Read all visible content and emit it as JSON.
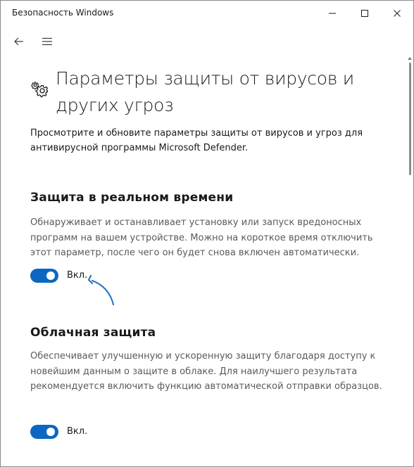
{
  "window": {
    "title": "Безопасность Windows",
    "controls": {
      "minimize_icon": "minimize-icon",
      "maximize_icon": "maximize-icon",
      "close_icon": "close-icon"
    }
  },
  "nav": {
    "back_icon": "back-arrow-icon",
    "menu_icon": "hamburger-menu-icon"
  },
  "page": {
    "icon": "gears-settings-icon",
    "title": "Параметры защиты от вирусов и других угроз",
    "intro": "Просмотрите и обновите параметры защиты от вирусов и угроз для антивирусной программы Microsoft Defender."
  },
  "sections": [
    {
      "title": "Защита в реальном времени",
      "description": "Обнаруживает и останавливает установку или запуск вредоносных программ на вашем устройстве. Можно на короткое время отключить этот параметр, после чего он будет снова включен автоматически.",
      "toggle_on": true,
      "toggle_label": "Вкл."
    },
    {
      "title": "Облачная защита",
      "description": "Обеспечивает улучшенную и ускоренную защиту благодаря доступу к новейшим данным о защите в облаке. Для наилучшего результата рекомендуется включить функцию автоматической отправки образцов.",
      "toggle_on": true,
      "toggle_label": "Вкл."
    }
  ],
  "colors": {
    "accent": "#0b67c2",
    "annotation_arrow": "#2a78c6",
    "text_primary": "#1a1a1a",
    "text_secondary": "#5a5a5a"
  }
}
